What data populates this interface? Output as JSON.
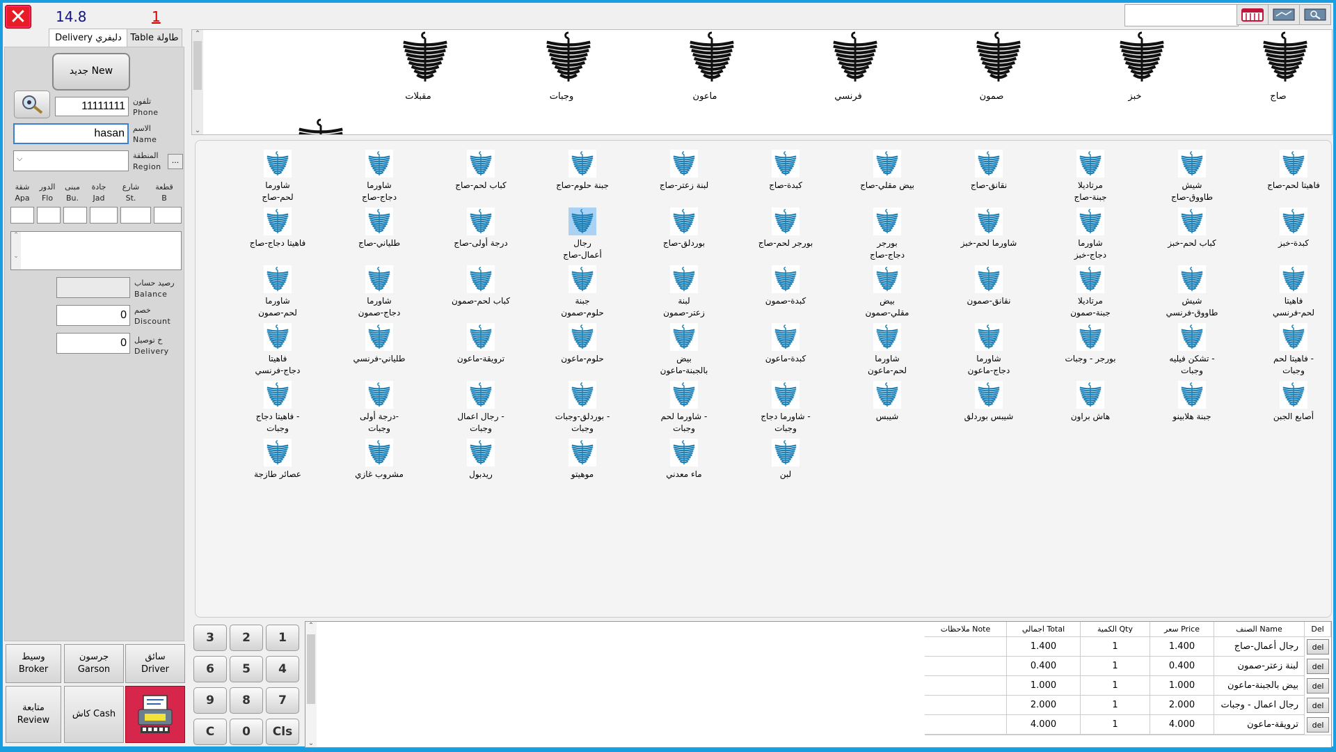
{
  "header": {
    "total": "14.8",
    "count": "1",
    "search_value": ""
  },
  "tabs": [
    {
      "label": "Delivery دليفري",
      "active": true
    },
    {
      "label": "Table طاولة",
      "active": false
    }
  ],
  "left": {
    "new_button": "جديد New",
    "phone_value": "11111111",
    "phone_label_ar": "تلفون",
    "phone_label_en": "Phone",
    "name_value": "hasan",
    "name_label_ar": "الاسم",
    "name_label_en": "Name",
    "region_label_ar": "المنطقة",
    "region_label_en": "Region",
    "region_btn": "...",
    "address_labels": [
      {
        "ar": "شقة",
        "en": "Apa"
      },
      {
        "ar": "الدور",
        "en": "Flo"
      },
      {
        "ar": "مبنى",
        "en": "Bu."
      },
      {
        "ar": "جادة",
        "en": "Jad"
      },
      {
        "ar": "شارع",
        "en": "St."
      },
      {
        "ar": "قطعة",
        "en": "B"
      }
    ],
    "balance_label_ar": "رصيد حساب",
    "balance_label_en": "Balance",
    "discount_label_ar": "خصم",
    "discount_label_en": "Discount",
    "discount_value": "0",
    "delivery_label_ar": "خ توصيل",
    "delivery_label_en": "Delivery",
    "delivery_value": "0"
  },
  "bottom_buttons": {
    "broker_ar": "وسيط",
    "broker_en": "Broker",
    "garson_ar": "جرسون",
    "garson_en": "Garson",
    "driver_ar": "سائق",
    "driver_en": "Driver",
    "review_ar": "متابعة",
    "review_en": "Review",
    "cash": "كاش Cash"
  },
  "categories": [
    "صاج",
    "خبز",
    "صمون",
    "فرنسي",
    "ماعون",
    "وجبات",
    "مقبلات"
  ],
  "items": [
    [
      "شاورما\nلحم-صاج",
      "شاورما\nدجاج-صاج",
      "كباب لحم-صاج",
      "جبنة حلوم-صاج",
      "لبنة زعتر-صاج",
      "كبدة-صاج",
      "بيض مقلي-صاج",
      "نقانق-صاج",
      "مرتاديلا\nجبنة-صاج",
      "شيش\nطاووق-صاج",
      "فاهيتا لحم-صاج"
    ],
    [
      "فاهيتا دجاج-صاج",
      "طلياني-صاج",
      "درجة أولى-صاج",
      "رجال\nأعمال-صاج",
      "بوردلق-صاج",
      "بورجر لحم-صاج",
      "بورجر\nدجاج-صاج",
      "شاورما لحم-خبز",
      "شاورما\nدجاج-خبز",
      "كباب لحم-خبز",
      "كبدة-خبز"
    ],
    [
      "شاورما\nلحم-صمون",
      "شاورما\nدجاج-صمون",
      "كباب لحم-صمون",
      "جبنة\nحلوم-صمون",
      "لبنة\nزعتر-صمون",
      "كبدة-صمون",
      "بيض\nمقلي-صمون",
      "نقانق-صمون",
      "مرتاديلا\nجبنة-صمون",
      "شيش\nطاووق-فرنسي",
      "فاهيتا\nلحم-فرنسي"
    ],
    [
      "فاهيتا\nدجاج-فرنسي",
      "طلياني-فرنسي",
      "ترويقة-ماعون",
      "حلوم-ماعون",
      "بيض\nبالجبنة-ماعون",
      "كبدة-ماعون",
      "شاورما\nلحم-ماعون",
      "شاورما\nدجاج-ماعون",
      "بورجر - وجبات",
      "تشكن فيليه -\nوجبات",
      "فاهيتا لحم -\nوجبات"
    ],
    [
      "فاهيتا دجاج -\nوجبات",
      "درجة أولى-\nوجبات",
      "رجال اعمال -\nوجبات",
      "بوردلق-وجبات -\nوجبات",
      "شاورما لحم -\nوجبات",
      "شاورما دجاج -\nوجبات",
      "شيبس",
      "شيبس بوردلق",
      "هاش براون",
      "جبنة هلابينو",
      "أصابع الجبن"
    ],
    [
      "عصائر طازجة",
      "مشروب غازي",
      "ريدبول",
      "موهيتو",
      "ماء معدني",
      "لبن"
    ]
  ],
  "keypad": [
    "3",
    "2",
    "1",
    "6",
    "5",
    "4",
    "9",
    "8",
    "7",
    "C",
    "0",
    "Cls"
  ],
  "order": {
    "headers": {
      "del": "Del",
      "name": "الصنف Name",
      "price": "سعر Price",
      "qty": "الكمية Qty",
      "total": "اجمالي Total",
      "note": "ملاحظات Note"
    },
    "del_label": "del",
    "rows": [
      {
        "name": "رجال أعمال-صاج",
        "price": "1.400",
        "qty": "1",
        "total": "1.400",
        "note": ""
      },
      {
        "name": "لبنة زعتر-صمون",
        "price": "0.400",
        "qty": "1",
        "total": "0.400",
        "note": ""
      },
      {
        "name": "بيض بالجبنة-ماعون",
        "price": "1.000",
        "qty": "1",
        "total": "1.000",
        "note": ""
      },
      {
        "name": "رجال اعمال - وجبات",
        "price": "2.000",
        "qty": "1",
        "total": "2.000",
        "note": ""
      },
      {
        "name": "ترويقة-ماعون",
        "price": "4.000",
        "qty": "1",
        "total": "4.000",
        "note": ""
      }
    ]
  },
  "colors": {
    "accent": "#1a9ee0",
    "close": "#e81c24",
    "printer": "#d6264b",
    "icon": "#1b7fb5",
    "selected": "#a9d2f5"
  }
}
